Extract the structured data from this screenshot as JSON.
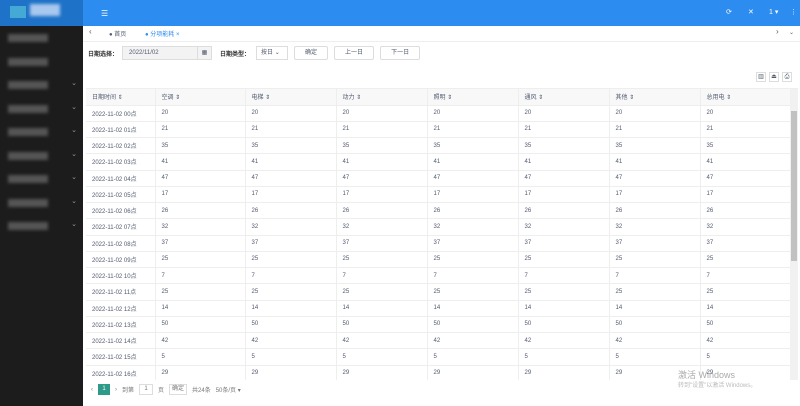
{
  "header": {
    "user": "1 ▾"
  },
  "tabs": [
    {
      "label": "首页"
    },
    {
      "label": "分项能耗",
      "active": true
    }
  ],
  "filters": {
    "date_label": "日期选择：",
    "date_value": "2022/11/02",
    "type_label": "日期类型：",
    "type_value": "按日",
    "confirm": "确定",
    "prev": "上一日",
    "next": "下一日"
  },
  "table": {
    "columns": [
      "日期时间 ⇕",
      "空调 ⇕",
      "电梯 ⇕",
      "动力 ⇕",
      "照明 ⇕",
      "通风 ⇕",
      "其他 ⇕",
      "总用电 ⇕"
    ],
    "rows": [
      [
        "2022-11-02 00点",
        20,
        20,
        20,
        20,
        20,
        20,
        20
      ],
      [
        "2022-11-02 01点",
        21,
        21,
        21,
        21,
        21,
        21,
        21
      ],
      [
        "2022-11-02 02点",
        35,
        35,
        35,
        35,
        35,
        35,
        35
      ],
      [
        "2022-11-02 03点",
        41,
        41,
        41,
        41,
        41,
        41,
        41
      ],
      [
        "2022-11-02 04点",
        47,
        47,
        47,
        47,
        47,
        47,
        47
      ],
      [
        "2022-11-02 05点",
        17,
        17,
        17,
        17,
        17,
        17,
        17
      ],
      [
        "2022-11-02 06点",
        26,
        26,
        26,
        26,
        26,
        26,
        26
      ],
      [
        "2022-11-02 07点",
        32,
        32,
        32,
        32,
        32,
        32,
        32
      ],
      [
        "2022-11-02 08点",
        37,
        37,
        37,
        37,
        37,
        37,
        37
      ],
      [
        "2022-11-02 09点",
        25,
        25,
        25,
        25,
        25,
        25,
        25
      ],
      [
        "2022-11-02 10点",
        7,
        7,
        7,
        7,
        7,
        7,
        7
      ],
      [
        "2022-11-02 11点",
        25,
        25,
        25,
        25,
        25,
        25,
        25
      ],
      [
        "2022-11-02 12点",
        14,
        14,
        14,
        14,
        14,
        14,
        14
      ],
      [
        "2022-11-02 13点",
        50,
        50,
        50,
        50,
        50,
        50,
        50
      ],
      [
        "2022-11-02 14点",
        42,
        42,
        42,
        42,
        42,
        42,
        42
      ],
      [
        "2022-11-02 15点",
        5,
        5,
        5,
        5,
        5,
        5,
        5
      ],
      [
        "2022-11-02 16点",
        29,
        29,
        29,
        29,
        29,
        29,
        29
      ]
    ]
  },
  "pagination": {
    "current": "1",
    "goto_label": "到第",
    "goto_value": "1",
    "page_unit": "页",
    "confirm": "确定",
    "total": "共24条",
    "page_size": "50条/页 ▾"
  },
  "watermark": {
    "line1": "激活 Windows",
    "line2": "转到\"设置\"以激活 Windows。"
  },
  "colors": {
    "header": "#2d8cf0",
    "sidebar": "#1c1c1c",
    "active_page": "#2d9a8a"
  }
}
